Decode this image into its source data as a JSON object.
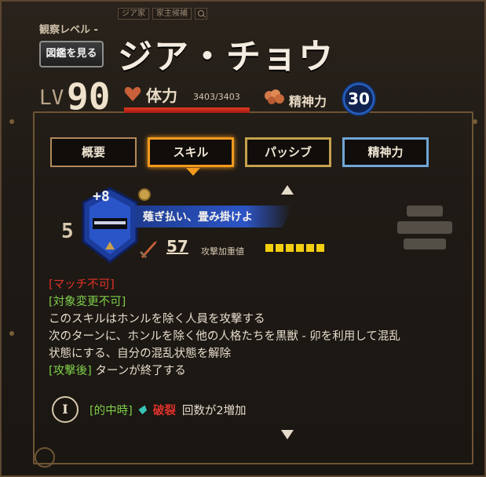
{
  "header": {
    "observation_level_label": "観察レベル -",
    "catalog_button": "図鑑を見る",
    "tags": [
      "ジア家",
      "家主候補"
    ],
    "character_name": "ジア・チョウ"
  },
  "stats": {
    "lv_label": "LV",
    "lv_value": "90",
    "hp_label": "体力",
    "hp_value": "3403/3403",
    "hp_fraction": 1.0,
    "sp_label": "精神力",
    "sp_value": "30"
  },
  "tabs": [
    {
      "label": "概要",
      "state": "normal"
    },
    {
      "label": "スキル",
      "state": "active"
    },
    {
      "label": "パッシブ",
      "state": "normal"
    },
    {
      "label": "精神力",
      "state": "normal"
    }
  ],
  "skill": {
    "number": "5",
    "plus": "+8",
    "name": "薙ぎ払い、畳み掛けよ",
    "attack_value": "57",
    "attack_weight_label": "攻撃加重値",
    "attack_weight_blocks": 6,
    "colors": {
      "weight": "#f3cf10",
      "name_bg": "#2c55c6"
    }
  },
  "description": {
    "line1": "[マッチ不可]",
    "line2": "[対象変更不可]",
    "line3": "このスキルはホンルを除く人員を攻撃する",
    "line4": "次のターンに、ホンルを除く他の人格たちを黒獣 - 卯を利用して混乱",
    "line5": "状態にする、自分の混乱状態を解除",
    "line6_tag": "[攻撃後]",
    "line6_text": " ターンが終了する"
  },
  "coin_effect": {
    "coin_numeral": "I",
    "on_hit": "[的中時]",
    "rupture": "破裂",
    "rest": "回数が2増加"
  }
}
